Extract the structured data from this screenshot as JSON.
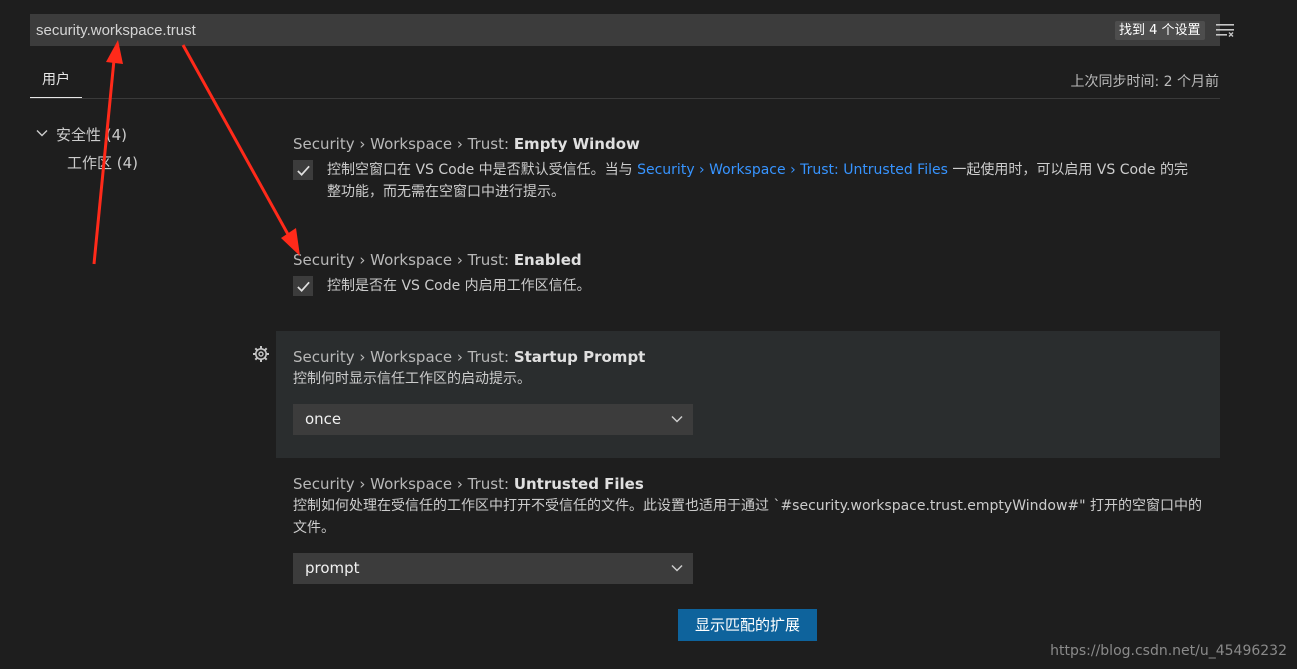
{
  "search": {
    "value": "security.workspace.trust",
    "result_badge": "找到 4 个设置",
    "filter_icon": "filter-list-icon"
  },
  "tabs": [
    {
      "label": "用户",
      "active": true
    }
  ],
  "sync_status": "上次同步时间: 2 个月前",
  "toc": {
    "group": {
      "label": "安全性 (4)",
      "expanded": true
    },
    "child": {
      "label": "工作区 (4)"
    }
  },
  "settings": [
    {
      "prefix": "Security › Workspace › Trust: ",
      "name": "Empty Window",
      "type": "checkbox",
      "checked": true,
      "desc_before": "控制空窗口在 VS Code 中是否默认受信任。当与 ",
      "desc_link": "Security › Workspace › Trust: Untrusted Files",
      "desc_after": " 一起使用时，可以启用 VS Code 的完整功能，而无需在空窗口中进行提示。"
    },
    {
      "prefix": "Security › Workspace › Trust: ",
      "name": "Enabled",
      "type": "checkbox",
      "checked": true,
      "desc": "控制是否在 VS Code 内启用工作区信任。"
    },
    {
      "prefix": "Security › Workspace › Trust: ",
      "name": "Startup Prompt",
      "type": "select",
      "desc": "控制何时显示信任工作区的启动提示。",
      "value": "once",
      "focused": true
    },
    {
      "prefix": "Security › Workspace › Trust: ",
      "name": "Untrusted Files",
      "type": "select",
      "desc": "控制如何处理在受信任的工作区中打开不受信任的文件。此设置也适用于通过 `#security.workspace.trust.emptyWindow#\" 打开的空窗口中的文件。",
      "value": "prompt"
    }
  ],
  "extensions_button": "显示匹配的扩展",
  "watermark": "https://blog.csdn.net/u_45496232",
  "colors": {
    "background": "#1e1e1e",
    "input_background": "#3c3c3c",
    "link": "#3794ff",
    "button": "#0e639c",
    "annotation_arrow": "#ff2a1a"
  }
}
